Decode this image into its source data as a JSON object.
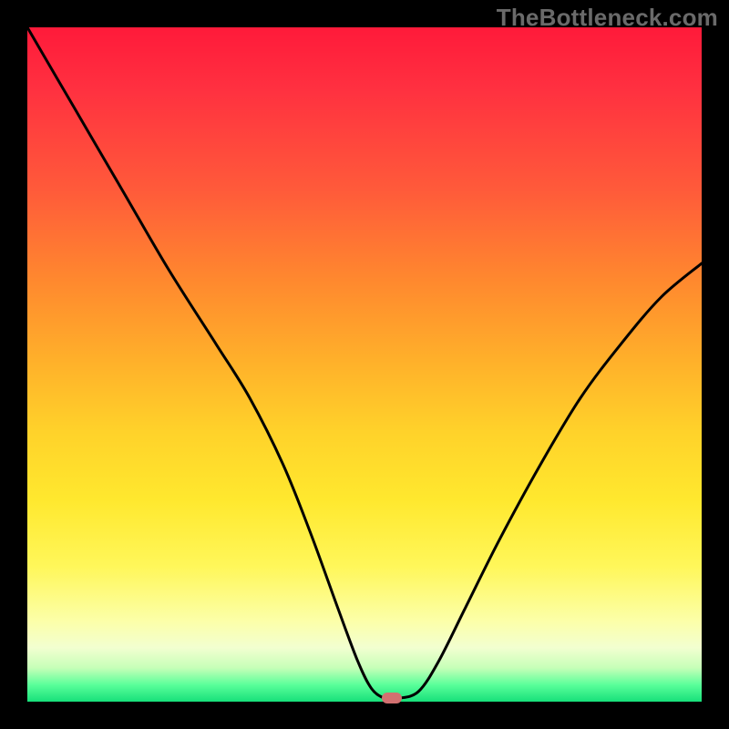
{
  "watermark": "TheBottleneck.com",
  "chart_data": {
    "type": "line",
    "title": "",
    "xlabel": "",
    "ylabel": "",
    "xlim": [
      0,
      100
    ],
    "ylim": [
      0,
      100
    ],
    "grid": false,
    "background_gradient": {
      "direction": "top-to-bottom",
      "stops": [
        {
          "pos": 0.0,
          "color": "#ff1a3a"
        },
        {
          "pos": 0.38,
          "color": "#ff8a2e"
        },
        {
          "pos": 0.7,
          "color": "#ffe82e"
        },
        {
          "pos": 0.92,
          "color": "#f2ffd0"
        },
        {
          "pos": 1.0,
          "color": "#17e07a"
        }
      ]
    },
    "series": [
      {
        "name": "bottleneck-curve",
        "x": [
          0,
          7,
          14,
          21,
          28,
          33,
          38,
          42,
          46,
          49,
          51,
          53,
          55,
          58,
          61,
          65,
          70,
          76,
          82,
          88,
          94,
          100
        ],
        "y": [
          100,
          88,
          76,
          64,
          53,
          45,
          35,
          25,
          14,
          6,
          2,
          0.5,
          0.5,
          1.5,
          6,
          14,
          24,
          35,
          45,
          53,
          60,
          65
        ]
      }
    ],
    "annotations": [
      {
        "name": "optimal-marker",
        "x": 54,
        "y": 0.5,
        "color": "#d27070"
      }
    ]
  }
}
